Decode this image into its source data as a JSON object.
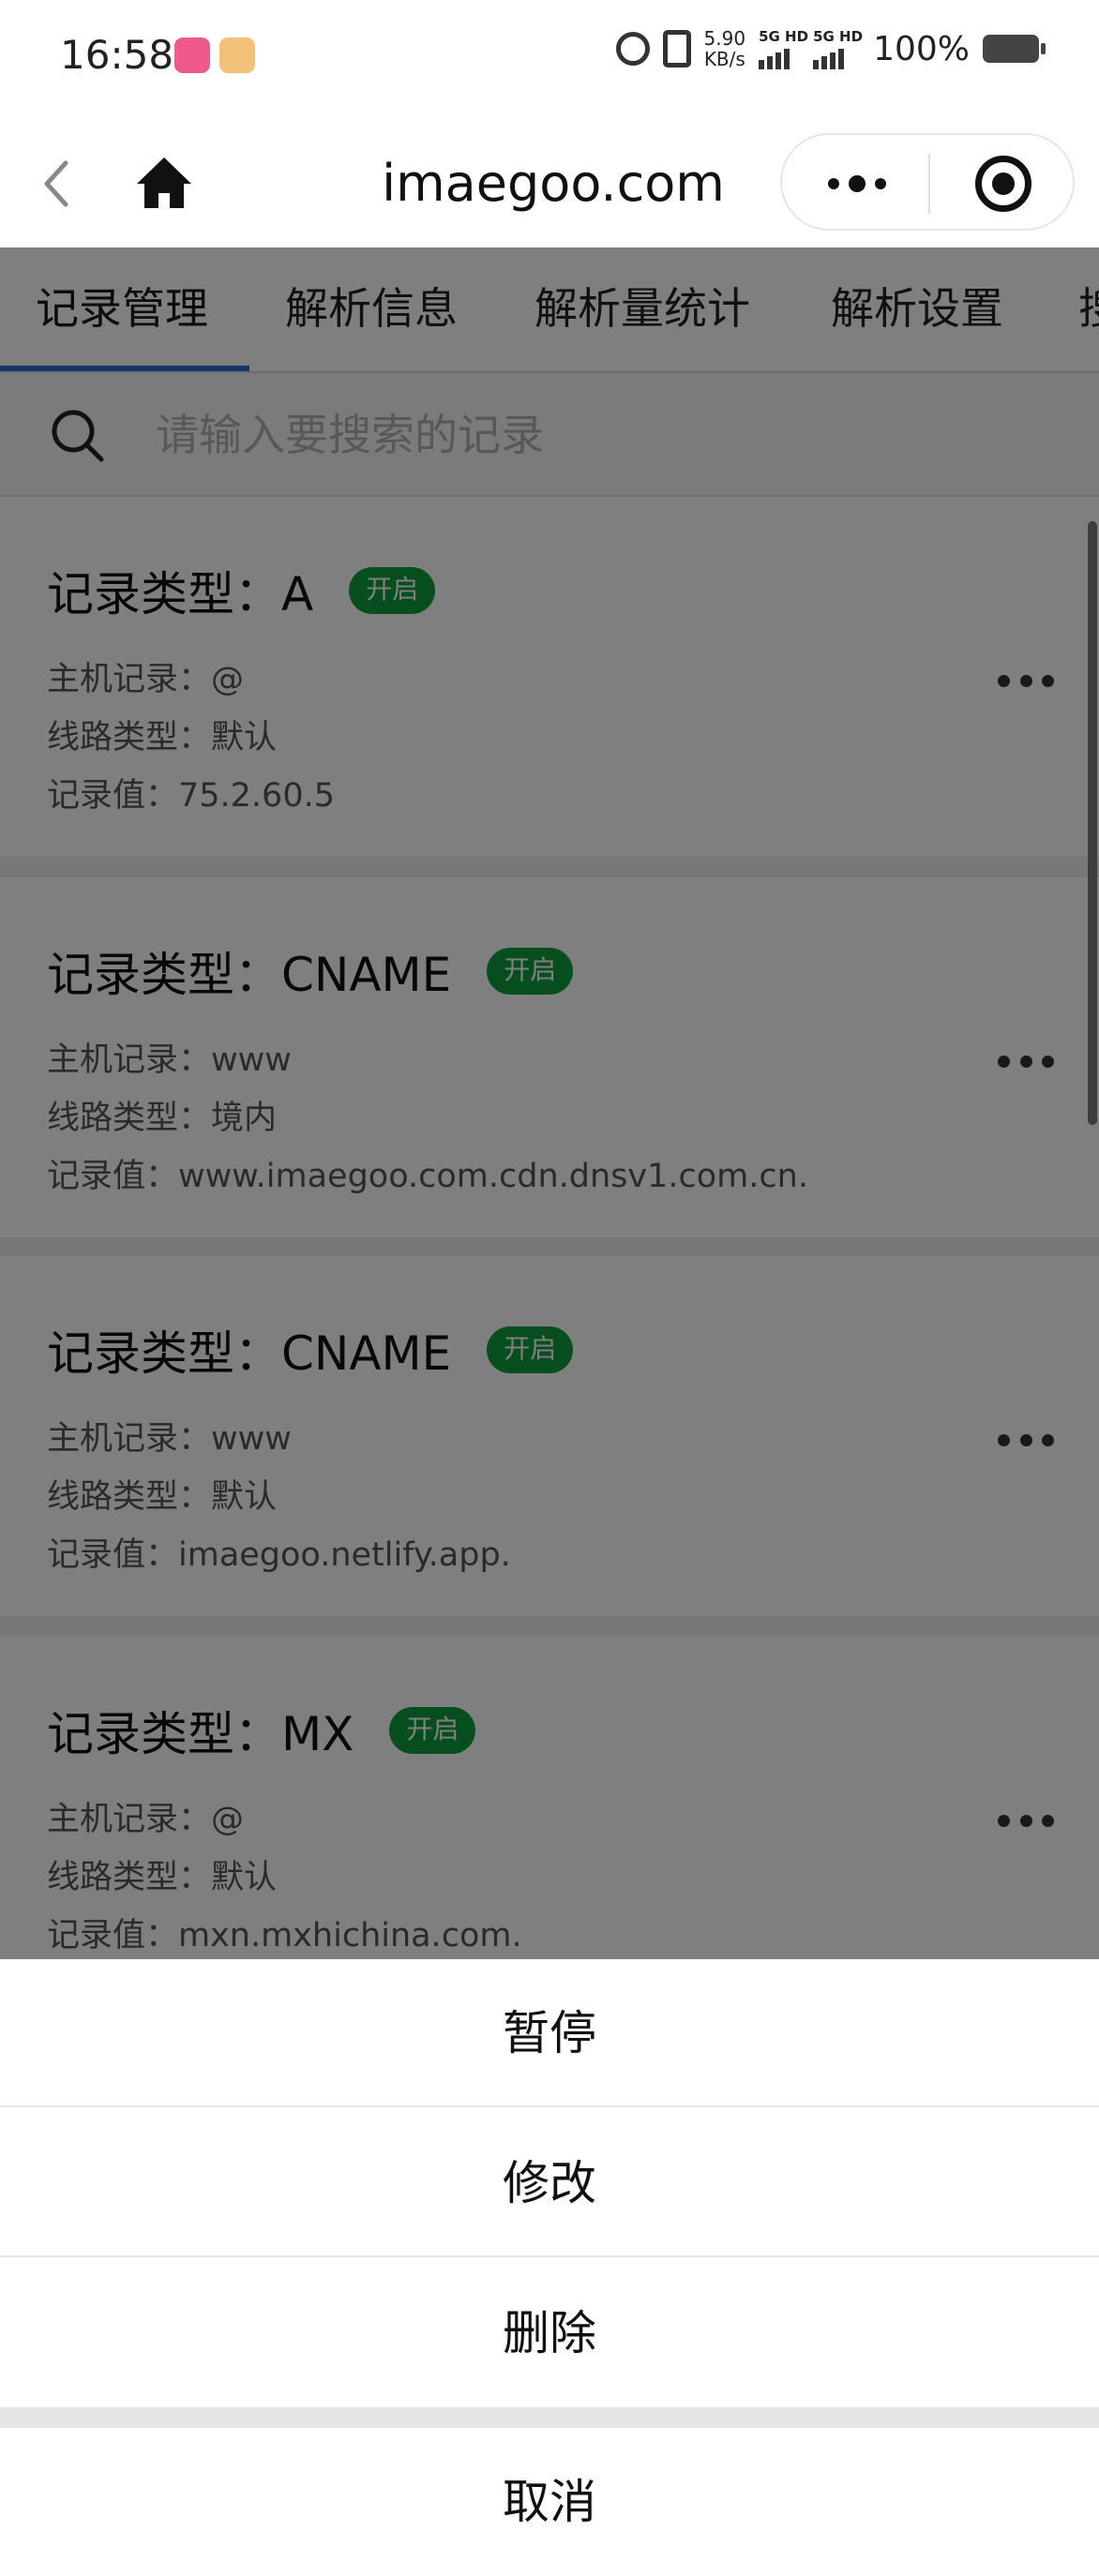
{
  "status_bar": {
    "time": "16:58",
    "net_speed_value": "5.90",
    "net_speed_unit": "KB/s",
    "signal1_label": "5G HD",
    "signal2_label": "5G HD",
    "battery": "100%"
  },
  "nav": {
    "title": "imaegoo.com"
  },
  "tabs": [
    {
      "label": "记录管理",
      "active": true
    },
    {
      "label": "解析信息"
    },
    {
      "label": "解析量统计"
    },
    {
      "label": "解析设置"
    },
    {
      "label": "搜"
    }
  ],
  "search": {
    "placeholder": "请输入要搜索的记录"
  },
  "records": [
    {
      "type": "记录类型：A",
      "status": "开启",
      "host": "主机记录：@",
      "line": "线路类型：默认",
      "value": "记录值：75.2.60.5"
    },
    {
      "type": "记录类型：CNAME",
      "status": "开启",
      "host": "主机记录：www",
      "line": "线路类型：境内",
      "value": "记录值：www.imaegoo.com.cdn.dnsv1.com.cn."
    },
    {
      "type": "记录类型：CNAME",
      "status": "开启",
      "host": "主机记录：www",
      "line": "线路类型：默认",
      "value": "记录值：imaegoo.netlify.app."
    },
    {
      "type": "记录类型：MX",
      "status": "开启",
      "host": "主机记录：@",
      "line": "线路类型：默认",
      "value": "记录值：mxn.mxhichina.com."
    }
  ],
  "action_sheet": {
    "pause": "暂停",
    "edit": "修改",
    "delete": "删除",
    "cancel": "取消"
  },
  "colors": {
    "badge_green": "#0f9d3e",
    "tab_accent": "#2f6fd6",
    "overlay": "rgba(0,0,0,0.5)"
  }
}
